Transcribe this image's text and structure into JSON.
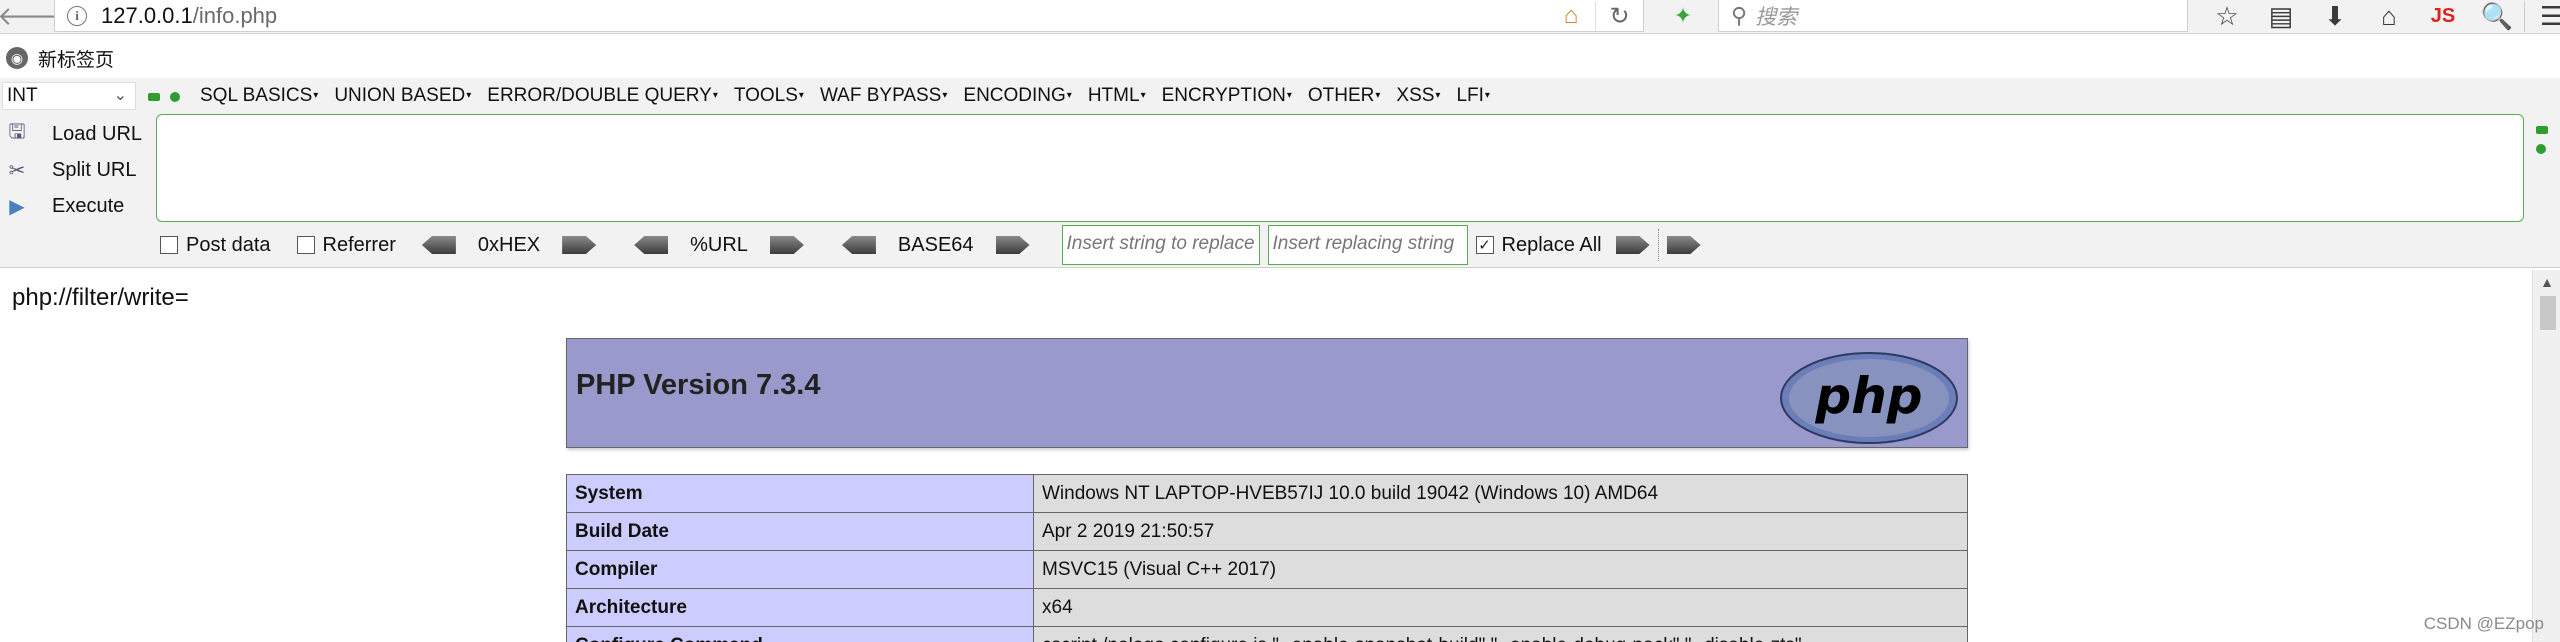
{
  "browser": {
    "back_glyph": "🡐",
    "url_host": "127.0.0.1",
    "url_path": "/info.php",
    "search_placeholder": "搜索",
    "js_label": "JS"
  },
  "bookmarks": [
    {
      "label": "新标签页"
    }
  ],
  "hackbar": {
    "type_select_value": "INT",
    "menus": [
      "SQL BASICS",
      "UNION BASED",
      "ERROR/DOUBLE QUERY",
      "TOOLS",
      "WAF BYPASS",
      "ENCODING",
      "HTML",
      "ENCRYPTION",
      "OTHER",
      "XSS",
      "LFI"
    ],
    "load_url": "Load URL",
    "split_url": "Split URL",
    "execute": "Execute",
    "post_data": "Post data",
    "referrer": "Referrer",
    "hex": "0xHEX",
    "url_enc": "%URL",
    "base64": "BASE64",
    "insert_placeholder": "Insert string to replace",
    "replacing_placeholder": "Insert replacing string",
    "replace_all": "Replace All",
    "replace_all_checked": true
  },
  "page": {
    "pre_text": "php://filter/write=",
    "php_version_title": "PHP Version 7.3.4",
    "logo_text": "php",
    "rows": [
      {
        "key": "System",
        "value": "Windows NT LAPTOP-HVEB57IJ 10.0 build 19042 (Windows 10) AMD64"
      },
      {
        "key": "Build Date",
        "value": "Apr 2 2019 21:50:57"
      },
      {
        "key": "Compiler",
        "value": "MSVC15 (Visual C++ 2017)"
      },
      {
        "key": "Architecture",
        "value": "x64"
      },
      {
        "key": "Configure Command",
        "value": "cscript /nologo configure.js \"--enable-snapshot-build\" \"--enable-debug-pack\" \"--disable-zts\""
      }
    ]
  },
  "watermark": "CSDN @EZpop",
  "colors": {
    "php_header": "#9999cc",
    "table_key": "#ccccff",
    "table_value": "#dddddd",
    "hackbar_accent": "#5aad4e"
  }
}
